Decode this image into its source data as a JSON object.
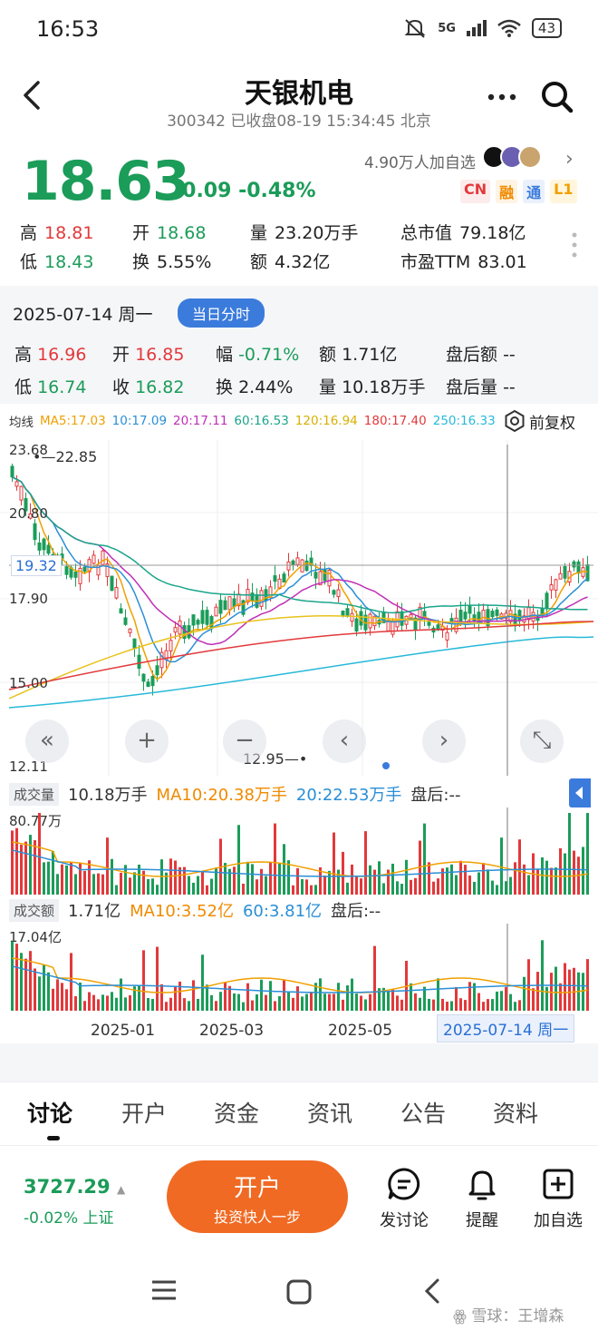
{
  "status": {
    "time": "16:53",
    "network": "5G",
    "battery": "43"
  },
  "header": {
    "name": "天银机电",
    "subtitle": "300342 已收盘08-19 15:34:45 北京"
  },
  "quote": {
    "price": "18.63",
    "change": "-0.09 -0.48%",
    "followers": "4.90万人加自选",
    "badges": [
      {
        "label": "CN",
        "color": "#e2393b"
      },
      {
        "label": "融",
        "color": "#f08a00"
      },
      {
        "label": "通",
        "color": "#3b7bdc"
      },
      {
        "label": "L1",
        "color": "#f0a000"
      }
    ],
    "high_label": "高",
    "high": "18.81",
    "open_label": "开",
    "open": "18.68",
    "vol_label": "量",
    "vol": "23.20万手",
    "mcap_label": "总市值",
    "mcap": "79.18亿",
    "low_label": "低",
    "low": "18.43",
    "turn_label": "换",
    "turn": "5.55%",
    "amt_label": "额",
    "amt": "4.32亿",
    "pe_label": "市盈TTM",
    "pe": "83.01"
  },
  "day": {
    "date": "2025-07-14 周一",
    "intraday_button": "当日分时",
    "high_label": "高",
    "high": "16.96",
    "open_label": "开",
    "open": "16.85",
    "amp_label": "幅",
    "amp": "-0.71%",
    "amt_label": "额",
    "amt": "1.71亿",
    "after_amt_label": "盘后额",
    "after_amt": "--",
    "low_label": "低",
    "low": "16.74",
    "close_label": "收",
    "close": "16.82",
    "turn_label": "换",
    "turn": "2.44%",
    "vol_label": "量",
    "vol": "10.18万手",
    "after_vol_label": "盘后量",
    "after_vol": "--"
  },
  "ma": {
    "label": "均线",
    "items": [
      {
        "text": "MA5:17.03",
        "color": "#f0a000"
      },
      {
        "text": "10:17.09",
        "color": "#2a8fd6"
      },
      {
        "text": "20:17.11",
        "color": "#c02fb8"
      },
      {
        "text": "60:16.53",
        "color": "#1aa58a"
      },
      {
        "text": "120:16.94",
        "color": "#e8c21b"
      },
      {
        "text": "180:17.40",
        "color": "#e2393b"
      },
      {
        "text": "250:16.33",
        "color": "#27b9d9"
      }
    ],
    "fq_label": "前复权"
  },
  "kline": {
    "y_labels": [
      "23.68",
      "20.80",
      "17.90",
      "15.00",
      "12.11"
    ],
    "high_marker": "22.85",
    "low_marker": "12.95",
    "cursor_price": "19.32",
    "nav": [
      "«",
      "+",
      "−",
      "‹",
      "›",
      "⤡"
    ]
  },
  "volume": {
    "label": "成交量",
    "value": "10.18万手",
    "ma10": "MA10:20.38万手",
    "ma20": "20:22.53万手",
    "after": "盘后:--",
    "max": "80.77万"
  },
  "amount": {
    "label": "成交额",
    "value": "1.71亿",
    "ma10": "MA10:3.52亿",
    "ma60": "60:3.81亿",
    "after": "盘后:--",
    "max": "17.04亿"
  },
  "x_axis": {
    "labels": [
      "2025-01",
      "2025-03",
      "2025-05"
    ],
    "cursor_date": "2025-07-14 周一"
  },
  "tabs": [
    "讨论",
    "开户",
    "资金",
    "资讯",
    "公告",
    "资料"
  ],
  "bottom": {
    "index_value": "3727.29",
    "index_change": "-0.02% 上证",
    "open_title": "开户",
    "open_sub": "投资快人一步",
    "actions": [
      "发讨论",
      "提醒",
      "加自选"
    ]
  },
  "watermark": "雪球：王增森",
  "colors": {
    "up": "#e2393b",
    "down": "#1b9c59",
    "accent": "#3b7bdc",
    "cta": "#f06a23"
  }
}
